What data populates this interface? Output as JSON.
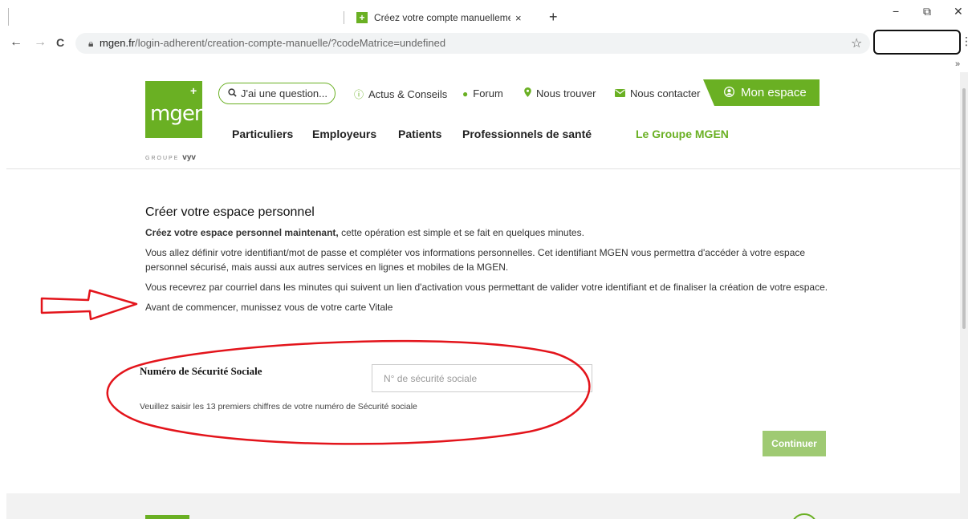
{
  "browser": {
    "tab_title": "Créez votre compte manuellement",
    "tab_favicon": "+",
    "tab_close": "×",
    "new_tab": "+",
    "url_host": "mgen.fr",
    "url_rest": "/login-adherent/creation-compte-manuelle/?codeMatrice=undefined",
    "back": "←",
    "forward": "→",
    "reload": "C",
    "minimize": "−",
    "restore": "⧉",
    "close": "✕",
    "star": "☆",
    "menu": "⋮",
    "overflow": "»"
  },
  "header": {
    "logo_text": "mgen",
    "logo_plus": "+",
    "logo_sub_group": "GROUPE",
    "logo_sub_brand": "vyv",
    "search_label": "J'ai une question...",
    "utility_links": {
      "actus": "Actus & Conseils",
      "forum": "Forum",
      "nous_trouver": "Nous trouver",
      "nous_contacter": "Nous contacter"
    },
    "mon_espace": "Mon espace",
    "main_nav": {
      "particuliers": "Particuliers",
      "employeurs": "Employeurs",
      "patients": "Patients",
      "professionnels": "Professionnels de santé",
      "groupe": "Le Groupe MGEN"
    }
  },
  "content": {
    "title": "Créer votre espace personnel",
    "intro_bold": "Créez votre espace personnel maintenant,",
    "intro_rest": " cette opération est simple et se fait en quelques minutes.",
    "para2": "Vous allez définir votre identifiant/mot de passe et compléter vos informations personnelles. Cet identifiant MGEN vous permettra d'accéder à votre espace personnel sécurisé, mais aussi aux autres services en lignes et mobiles de la MGEN.",
    "para3": "Vous recevrez par courriel dans les minutes qui suivent un lien d'activation vous permettant de valider votre identifiant et de finaliser la création de votre espace.",
    "para4": "Avant de commencer, munissez vous de votre carte Vitale"
  },
  "form": {
    "ss_label": "Numéro de Sécurité Sociale",
    "ss_placeholder": "N° de sécurité sociale",
    "ss_value": "",
    "ss_help": "Veuillez saisir les 13 premiers chiffres de votre numéro de Sécurité sociale",
    "submit": "Continuer"
  },
  "colors": {
    "brand_green": "#6ab023",
    "button_disabled_green": "#9fca73",
    "annotation_red": "#e3141b"
  }
}
